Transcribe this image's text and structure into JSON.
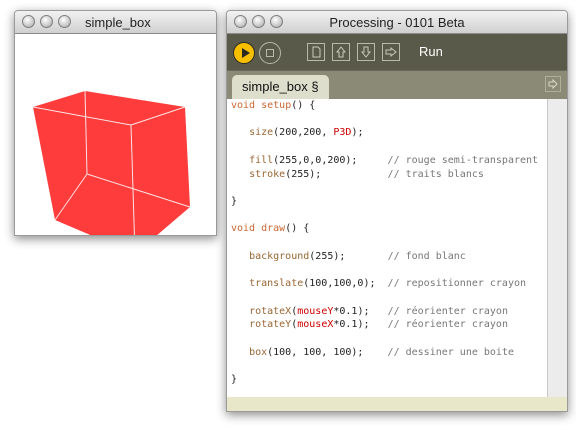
{
  "sketch_window": {
    "title": "simple_box"
  },
  "ide_window": {
    "title": "Processing - 0101 Beta",
    "toolbar": {
      "run_label": "Run"
    },
    "tab": {
      "label": "simple_box §"
    }
  },
  "colors": {
    "cube_fill": "#ff3c3c",
    "toolbar": "#5a5a4a",
    "run_button": "#f6c000"
  },
  "code_lines": [
    [
      "void setup() {"
    ],
    [
      ""
    ],
    [
      "   size(200,200, P3D);"
    ],
    [
      ""
    ],
    [
      "   fill(255,0,0,200);     // rouge semi-transparent"
    ],
    [
      "   stroke(255);           // traits blancs"
    ],
    [
      ""
    ],
    [
      "}"
    ],
    [
      ""
    ],
    [
      "void draw() {"
    ],
    [
      ""
    ],
    [
      "   background(255);       // fond blanc"
    ],
    [
      ""
    ],
    [
      "   translate(100,100,0);  // repositionner crayon"
    ],
    [
      ""
    ],
    [
      "   rotateX(mouseY*0.1);   // réorienter crayon"
    ],
    [
      "   rotateY(mouseX*0.1);   // réorienter crayon"
    ],
    [
      ""
    ],
    [
      "   box(100, 100, 100);    // dessiner une boite"
    ],
    [
      ""
    ],
    [
      "}"
    ]
  ],
  "code_tokens": [
    [
      {
        "t": "void",
        "c": "kw"
      },
      {
        "t": " "
      },
      {
        "t": "setup",
        "c": "kw"
      },
      {
        "t": "() {"
      }
    ],
    [],
    [
      {
        "t": "   "
      },
      {
        "t": "size",
        "c": "fn"
      },
      {
        "t": "(200,200, "
      },
      {
        "t": "P3D",
        "c": "ct"
      },
      {
        "t": ");"
      }
    ],
    [],
    [
      {
        "t": "   "
      },
      {
        "t": "fill",
        "c": "fn"
      },
      {
        "t": "(255,0,0,200);     "
      },
      {
        "t": "// rouge semi-transparent",
        "c": "cm"
      }
    ],
    [
      {
        "t": "   "
      },
      {
        "t": "stroke",
        "c": "fn"
      },
      {
        "t": "(255);           "
      },
      {
        "t": "// traits blancs",
        "c": "cm"
      }
    ],
    [],
    [
      {
        "t": "}"
      }
    ],
    [],
    [
      {
        "t": "void",
        "c": "kw"
      },
      {
        "t": " "
      },
      {
        "t": "draw",
        "c": "kw"
      },
      {
        "t": "() {"
      }
    ],
    [],
    [
      {
        "t": "   "
      },
      {
        "t": "background",
        "c": "fn"
      },
      {
        "t": "(255);       "
      },
      {
        "t": "// fond blanc",
        "c": "cm"
      }
    ],
    [],
    [
      {
        "t": "   "
      },
      {
        "t": "translate",
        "c": "fn"
      },
      {
        "t": "(100,100,0);  "
      },
      {
        "t": "// repositionner crayon",
        "c": "cm"
      }
    ],
    [],
    [
      {
        "t": "   "
      },
      {
        "t": "rotateX",
        "c": "fn"
      },
      {
        "t": "("
      },
      {
        "t": "mouseY",
        "c": "ct"
      },
      {
        "t": "*0.1);   "
      },
      {
        "t": "// réorienter crayon",
        "c": "cm"
      }
    ],
    [
      {
        "t": "   "
      },
      {
        "t": "rotateY",
        "c": "fn"
      },
      {
        "t": "("
      },
      {
        "t": "mouseX",
        "c": "ct"
      },
      {
        "t": "*0.1);   "
      },
      {
        "t": "// réorienter crayon",
        "c": "cm"
      }
    ],
    [],
    [
      {
        "t": "   "
      },
      {
        "t": "box",
        "c": "fn"
      },
      {
        "t": "(100, 100, 100);    "
      },
      {
        "t": "// dessiner une boite",
        "c": "cm"
      }
    ],
    [],
    [
      {
        "t": "}"
      }
    ]
  ]
}
